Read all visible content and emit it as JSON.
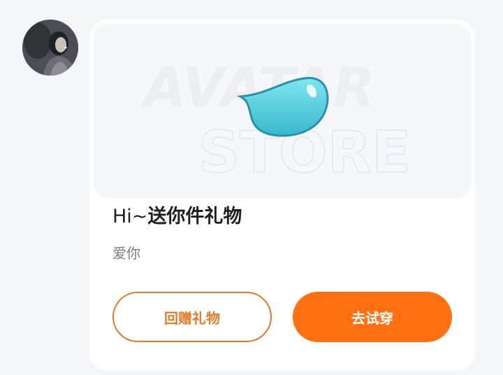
{
  "sender": {
    "avatar_alt": ""
  },
  "gift_card": {
    "banner_watermark_line1": "AVATAR",
    "banner_watermark_line2": "STORE",
    "title_prefix": "Hi~",
    "title_main": "送你件礼物",
    "message": "爱你",
    "return_gift_label": "回赠礼物",
    "try_on_label": "去试穿"
  },
  "colors": {
    "accent": "#ff7010",
    "accent_outline": "#e07c2c",
    "gift_item": "#4fd0de",
    "page_bg": "#f4f6f9"
  },
  "icons": {
    "gift_item": "teardrop-accessory-icon"
  }
}
